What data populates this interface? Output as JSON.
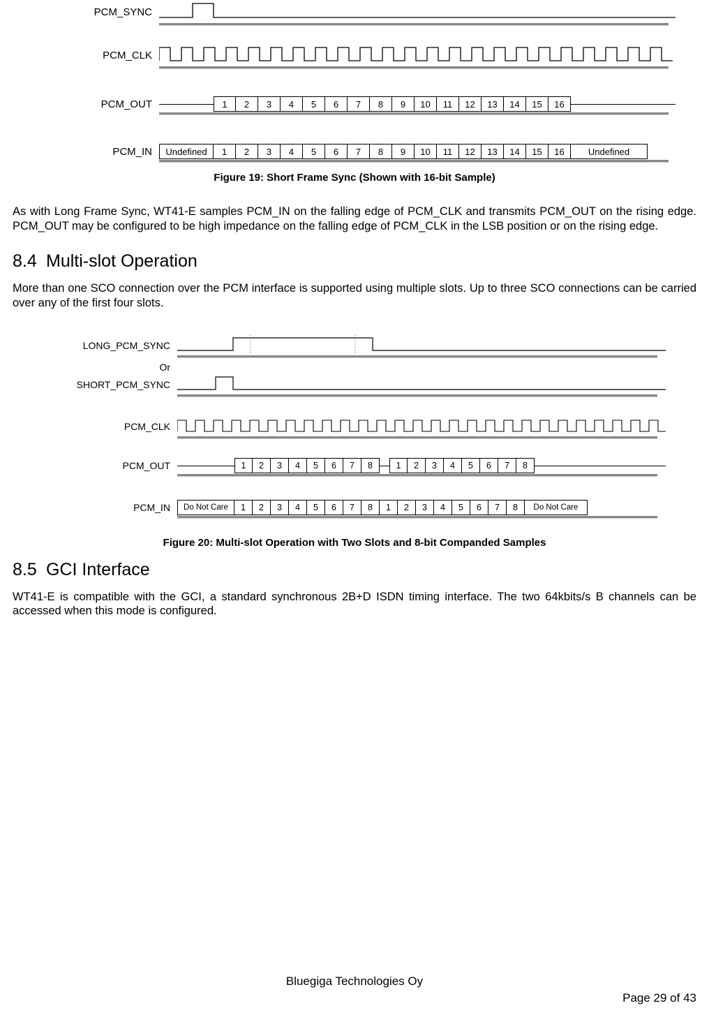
{
  "fig19": {
    "caption": "Figure 19: Short Frame Sync (Shown with 16-bit Sample)",
    "labels": {
      "sync": "PCM_SYNC",
      "clk": "PCM_CLK",
      "out": "PCM_OUT",
      "in": "PCM_IN"
    },
    "cells16": [
      "1",
      "2",
      "3",
      "4",
      "5",
      "6",
      "7",
      "8",
      "9",
      "10",
      "11",
      "12",
      "13",
      "14",
      "15",
      "16"
    ],
    "undef": "Undefined"
  },
  "p1": "As with Long Frame Sync, WT41-E samples PCM_IN on the falling edge of PCM_CLK and transmits PCM_OUT on the rising edge. PCM_OUT may be configured to be high impedance on the falling edge of PCM_CLK in the LSB position or on the rising edge.",
  "s84": {
    "num": "8.4",
    "title": "Multi-slot Operation"
  },
  "p2": "More than one SCO connection over the PCM interface is supported using multiple slots. Up to three SCO connections can be carried over any of the first four slots.",
  "fig20": {
    "caption": "Figure 20: Multi-slot Operation with Two Slots and 8-bit Companded Samples",
    "labels": {
      "longsync": "LONG_PCM_SYNC",
      "or": "Or",
      "shortsync": "SHORT_PCM_SYNC",
      "clk": "PCM_CLK",
      "out": "PCM_OUT",
      "in": "PCM_IN"
    },
    "cells8": [
      "1",
      "2",
      "3",
      "4",
      "5",
      "6",
      "7",
      "8"
    ],
    "dnc": "Do Not Care"
  },
  "s85": {
    "num": "8.5",
    "title": "GCI Interface"
  },
  "p3": "WT41-E is compatible with the GCI, a standard synchronous 2B+D ISDN timing interface. The two 64kbits/s B channels can be accessed when this mode is configured.",
  "footer": {
    "company": "Bluegiga Technologies Oy",
    "page": "Page 29 of 43"
  }
}
